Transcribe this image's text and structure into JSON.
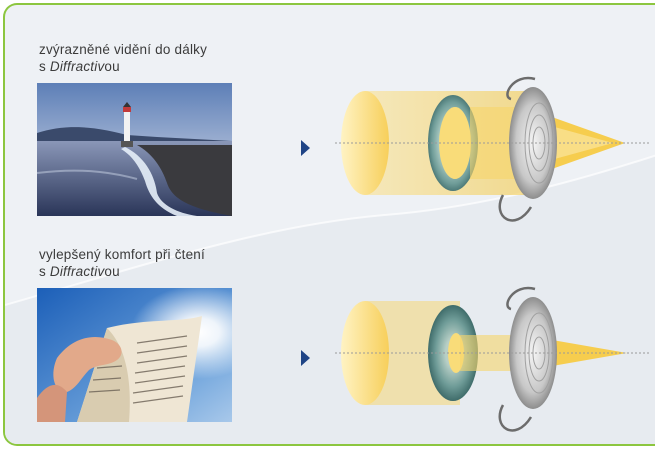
{
  "rows": [
    {
      "caption_line1": "zvýrazněné vidění do dálky",
      "caption_line2_prefix": "s ",
      "caption_line2_italic": "Diffractiv",
      "caption_line2_suffix": "ou",
      "photo_subject": "lighthouse-seascape",
      "pupil_size": "large"
    },
    {
      "caption_line1": "vylepšený komfort při čtení",
      "caption_line2_prefix": "s ",
      "caption_line2_italic": "Diffractiv",
      "caption_line2_suffix": "ou",
      "photo_subject": "reading-book-in-sunlight",
      "pupil_size": "small"
    }
  ],
  "colors": {
    "border": "#8cc63f",
    "arrow": "#1f4486",
    "background": "#eef1f5",
    "light_beam": "#f7cf5a",
    "iris": "#7fa7a3"
  },
  "icons": [
    "play-arrow-icon",
    "intraocular-lens-icon",
    "iris-icon"
  ]
}
